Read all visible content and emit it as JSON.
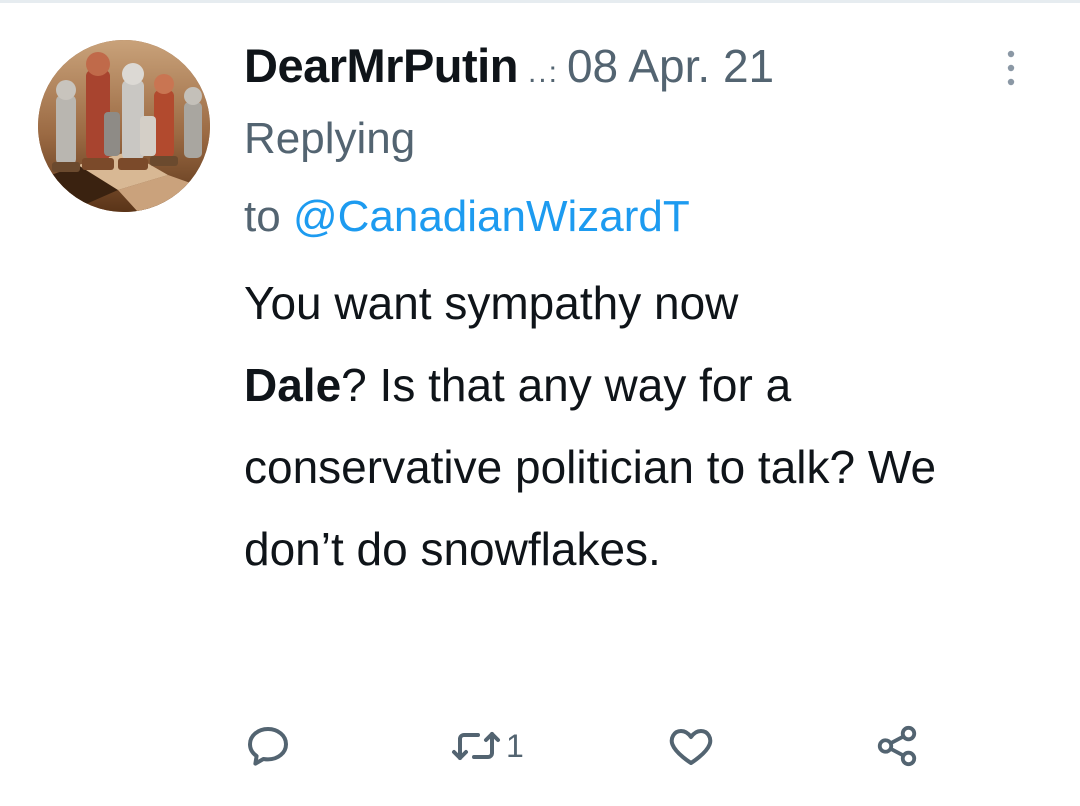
{
  "tweet": {
    "display_name": "DearMrPutin",
    "truncation": "..:",
    "date": "08 Apr. 21",
    "replying_label": "Replying",
    "to_label": "to",
    "mention": "@CanadianWizardT",
    "text_part1": "You want sympathy now",
    "text_bold": "Dale",
    "text_part2": "? Is that any way for a conservative politician to talk? We don’t do snowflakes."
  },
  "actions": {
    "reply_icon": "reply-icon",
    "retweet_icon": "retweet-icon",
    "retweet_count": "1",
    "like_icon": "heart-icon",
    "share_icon": "share-icon"
  },
  "colors": {
    "text": "#0f1419",
    "secondary": "#536471",
    "link": "#1d9bf0"
  }
}
